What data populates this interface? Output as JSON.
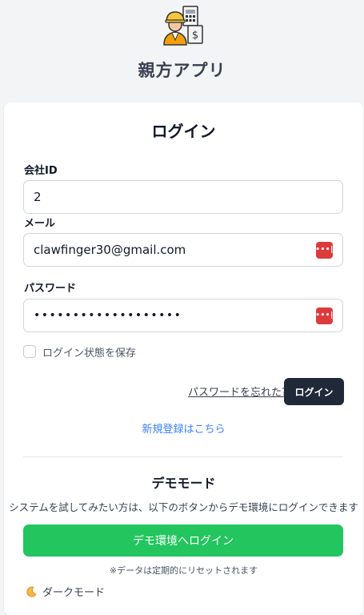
{
  "header": {
    "app_title": "親方アプリ",
    "logo_icon": "worker-with-documents-icon"
  },
  "login": {
    "title": "ログイン",
    "company_id_label": "会社ID",
    "company_id_value": "2",
    "email_label": "メール",
    "email_value": "clawfinger30@gmail.com",
    "password_label": "パスワード",
    "password_value": "•••••••••••••••••••",
    "password_manager_icon": "password-manager-icon",
    "remember_label": "ログイン状態を保存",
    "remember_checked": false,
    "forgot_password_link": "パスワードを忘れた?",
    "login_button": "ログイン",
    "register_link": "新規登録はこちら"
  },
  "demo": {
    "title": "デモモード",
    "description": "システムを試してみたい方は、以下のボタンからデモ環境にログインできます",
    "button_label": "デモ環境へログイン",
    "note": "※データは定期的にリセットされます"
  },
  "footer": {
    "dark_mode_label": "ダークモード",
    "dark_mode_icon": "moon-icon"
  },
  "colors": {
    "background": "#f3f4f6",
    "primary_button": "#1f2937",
    "demo_button": "#22c55e",
    "link": "#3b82f6",
    "password_manager": "#dc3b3b"
  }
}
